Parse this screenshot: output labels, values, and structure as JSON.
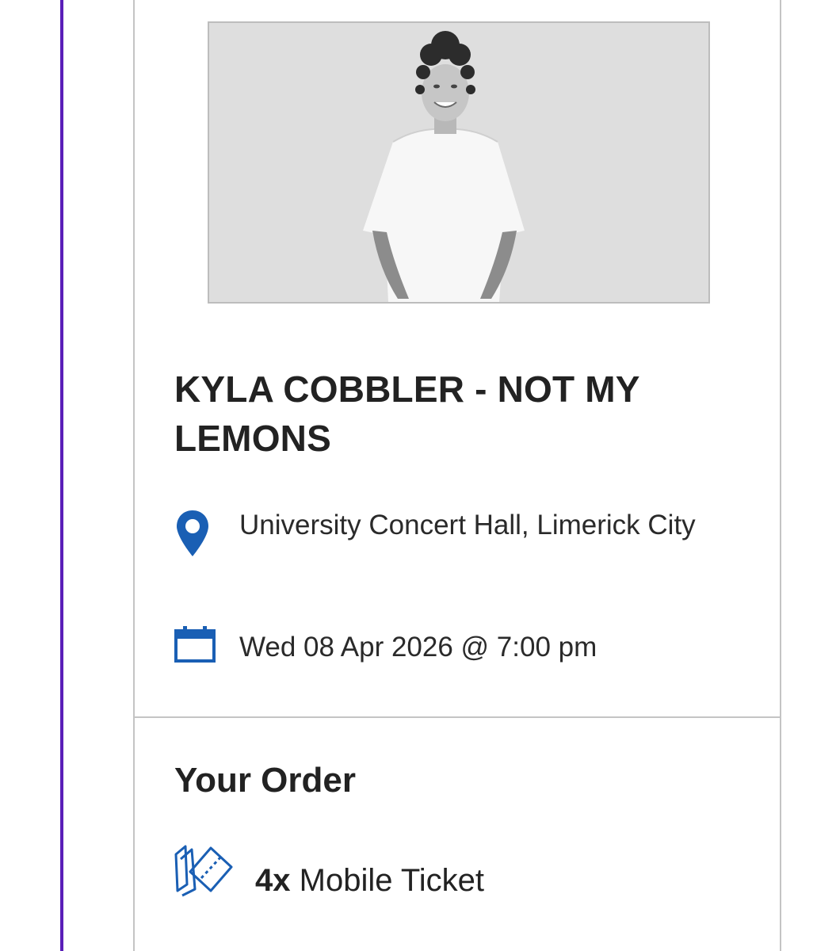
{
  "event": {
    "title": "KYLA COBBLER - NOT MY LEMONS",
    "venue": "University Concert Hall, Limerick City",
    "datetime": "Wed 08 Apr 2026 @ 7:00 pm",
    "image_icon": "performer-photo"
  },
  "icons": {
    "venue": "map-pin-icon",
    "date": "calendar-icon",
    "tickets": "tickets-icon"
  },
  "order": {
    "heading": "Your Order",
    "quantity": "4x",
    "ticket_type": "Mobile Ticket"
  },
  "colors": {
    "accent_line": "#5a1fb8",
    "icon_blue": "#1a5fb4",
    "border": "#c4c4c4",
    "text": "#222222"
  }
}
